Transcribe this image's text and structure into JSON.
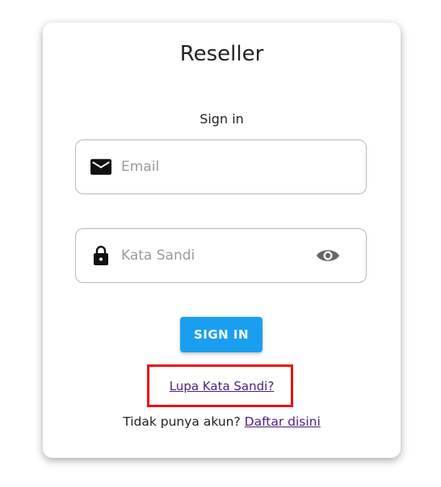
{
  "card": {
    "title": "Reseller",
    "subtitle": "Sign in"
  },
  "form": {
    "email": {
      "icon": "mail-icon",
      "placeholder": "Email",
      "value": ""
    },
    "password": {
      "icon": "lock-icon",
      "placeholder": "Kata Sandi",
      "value": "",
      "toggle_icon": "eye-icon"
    },
    "signin_label": "SIGN IN",
    "forgot_label": "Lupa Kata Sandi?",
    "register_prompt": "Tidak punya akun?",
    "register_link": "Daftar disini"
  },
  "colors": {
    "primary_button": "#1a9ff0",
    "link": "#4b1d7c",
    "highlight_box": "#ee1111"
  }
}
